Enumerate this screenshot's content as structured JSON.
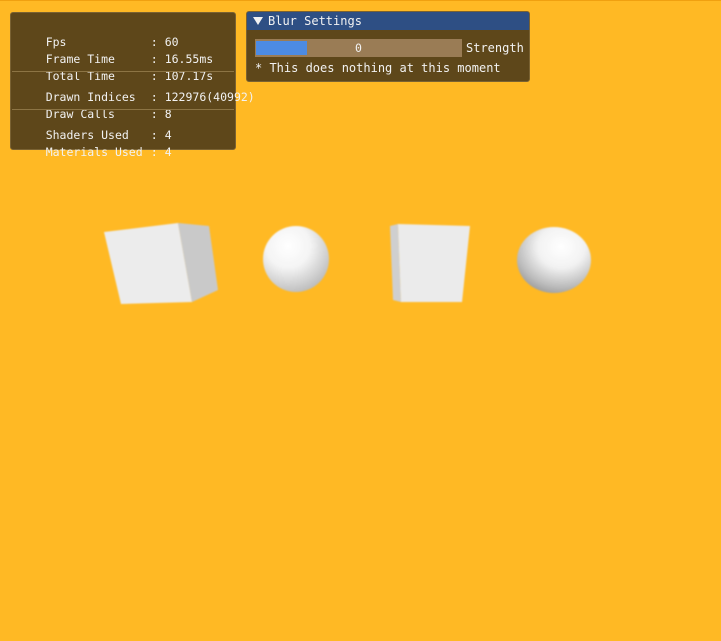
{
  "stats": {
    "rows": [
      {
        "label": "Fps",
        "value": "60"
      },
      {
        "label": "Frame Time",
        "value": "16.55ms"
      },
      {
        "label": "Total Time",
        "value": "107.17s"
      },
      {
        "label": "Drawn Indices",
        "value": "122976(40992)"
      },
      {
        "label": "Draw Calls",
        "value": "8"
      },
      {
        "label": "Shaders Used",
        "value": "4"
      },
      {
        "label": "Materials Used",
        "value": "4"
      }
    ],
    "separator": ":"
  },
  "blur_window": {
    "title": "Blur Settings",
    "slider": {
      "value": "0",
      "label": "Strength"
    },
    "note": "* This does nothing at this moment"
  },
  "colors": {
    "background": "#FFB924",
    "panel_bg": "#5E471A",
    "title_bar": "#2E4F84",
    "slider_track": "#9A7C55",
    "slider_grab": "#4C8BE3"
  },
  "scene": {
    "objects": [
      "cube",
      "sphere",
      "cube",
      "sphere"
    ]
  }
}
